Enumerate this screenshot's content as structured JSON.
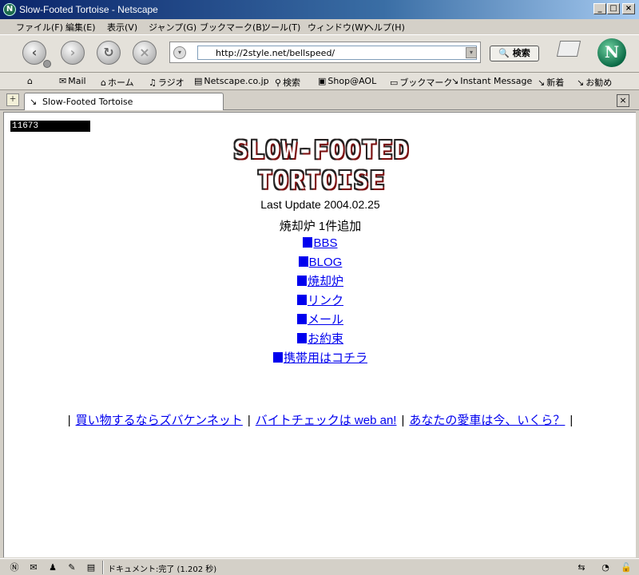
{
  "window": {
    "title": "Slow-Footed Tortoise - Netscape",
    "app_icon": "netscape-icon",
    "min_label": "_",
    "max_label": "□",
    "close_label": "×"
  },
  "menu": [
    "ファイル(F)",
    "編集(E)",
    "表示(V)",
    "ジャンプ(G)",
    "ブックマーク(B)",
    "ツール(T)",
    "ウィンドウ(W)",
    "ヘルプ(H)"
  ],
  "nav": {
    "url": "http://2style.net/bellspeed/",
    "search_label": "検索"
  },
  "personal_toolbar": {
    "items": [
      "Mail",
      "ホーム",
      "ラジオ",
      "Netscape.co.jp",
      "検索",
      "Shop@AOL",
      "ブックマーク",
      "Instant Message",
      "新着",
      "お勧め"
    ]
  },
  "tab": {
    "title": "Slow-Footed Tortoise",
    "close_label": "×"
  },
  "page": {
    "counter": "11673",
    "logo_line1": "SLOW-FOOTED",
    "logo_line2": "TORTOISE",
    "last_update": "Last Update 2004.02.25",
    "added_note": "焼却炉 1件追加",
    "links": [
      "BBS",
      "BLOG",
      "焼却炉",
      "リンク",
      "メール",
      "お約束",
      "携帯用はコチラ"
    ],
    "ad_sep": "|",
    "ads": [
      "買い物するならズバケンネット",
      "バイトチェックは web an!",
      "あなたの愛車は今、いくら？"
    ]
  },
  "status": {
    "text": "ドキュメント:完了 (1.202 秒)"
  },
  "colors": {
    "link": "#0000ee",
    "titlebar": "#0a246a",
    "counter_bg": "#000000"
  }
}
